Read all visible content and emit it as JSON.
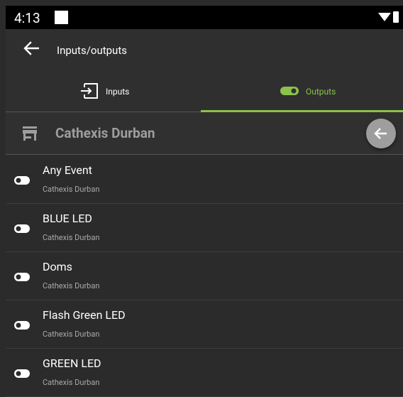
{
  "status_bar": {
    "time": "4:13"
  },
  "app_bar": {
    "title": "Inputs/outputs"
  },
  "tabs": [
    {
      "label": "Inputs",
      "icon": "input-icon",
      "selected": false
    },
    {
      "label": "Outputs",
      "icon": "toggle-icon",
      "selected": true
    }
  ],
  "site": {
    "name": "Cathexis Durban",
    "icon": "store-icon"
  },
  "outputs": [
    {
      "name": "Any Event",
      "site": "Cathexis Durban"
    },
    {
      "name": "BLUE LED",
      "site": "Cathexis Durban"
    },
    {
      "name": "Doms",
      "site": "Cathexis Durban"
    },
    {
      "name": "Flash Green LED",
      "site": "Cathexis Durban"
    },
    {
      "name": "GREEN LED",
      "site": "Cathexis Durban"
    }
  ],
  "colors": {
    "accent": "#8bc34a",
    "background": "#2b2b2b",
    "fab": "#9e9e9e"
  }
}
